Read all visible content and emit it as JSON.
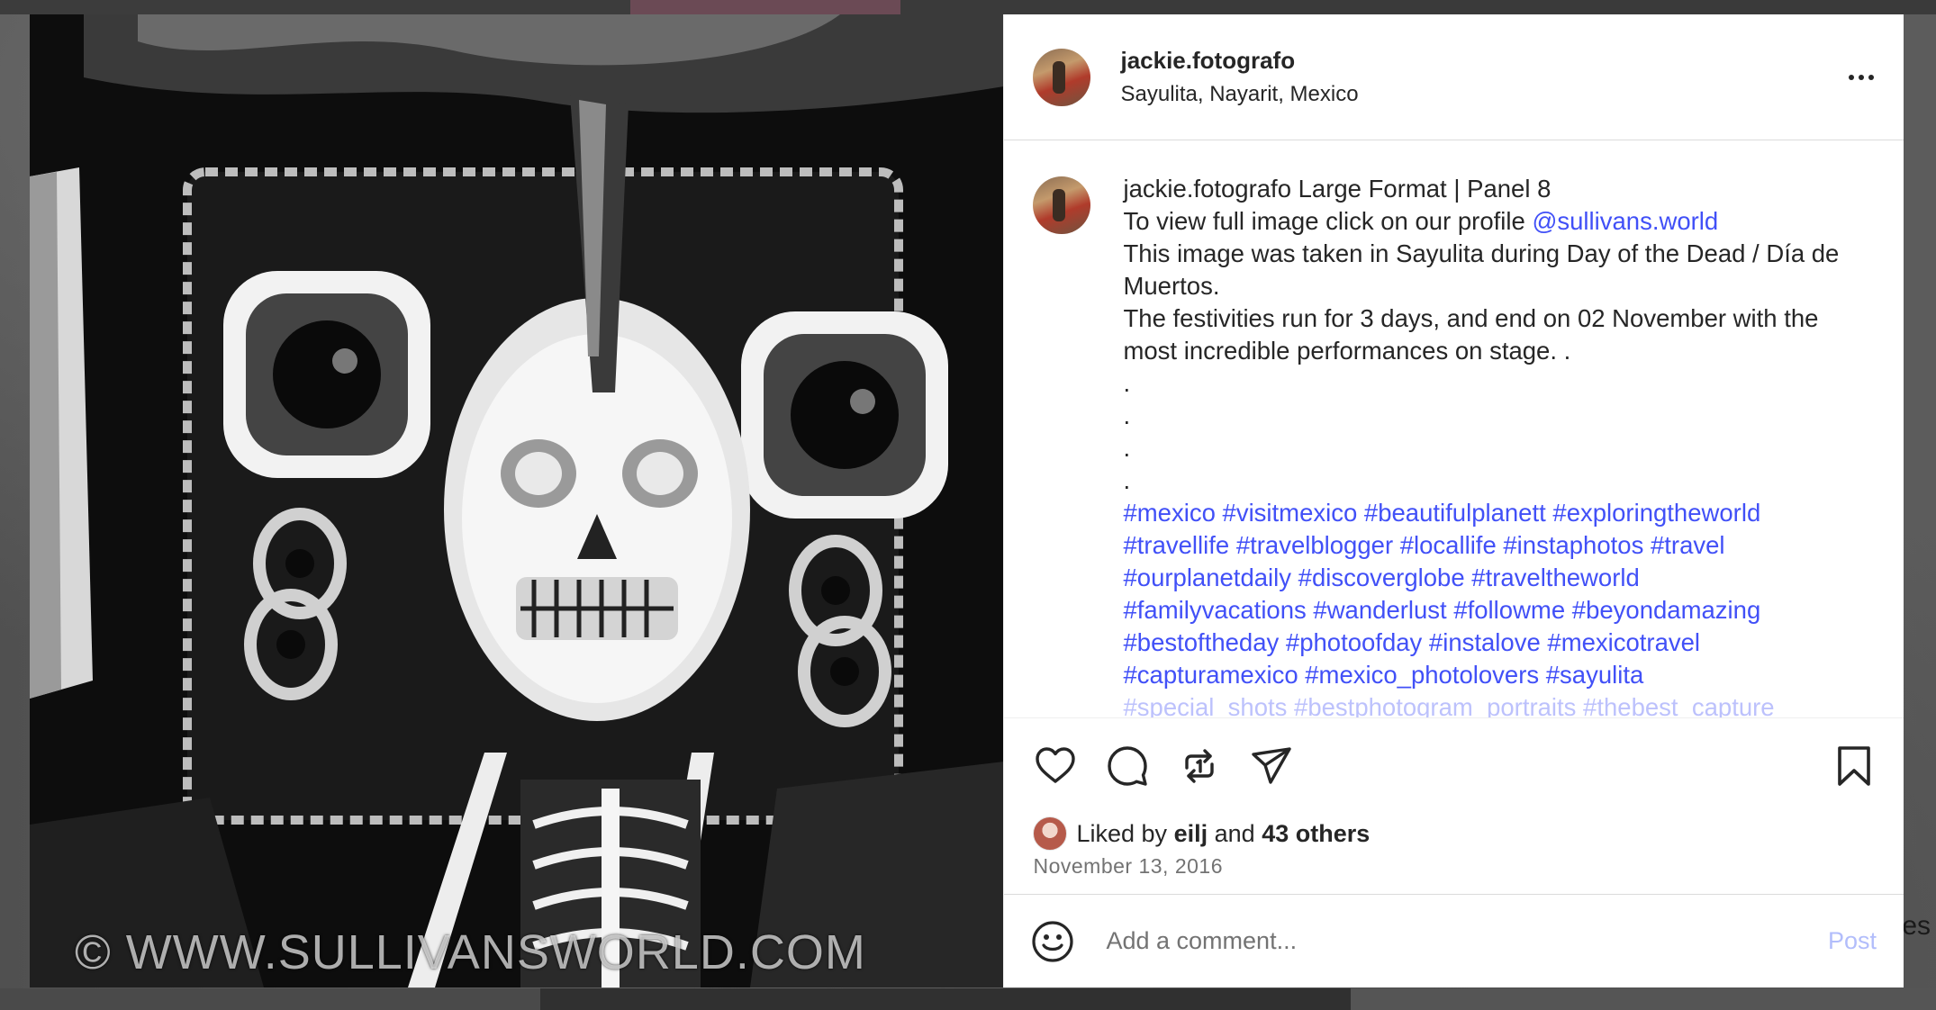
{
  "post": {
    "username": "jackie.fotografo",
    "location": "Sayulita, Nayarit, Mexico"
  },
  "photo": {
    "watermark": "© WWW.SULLIVANSWORLD.COM"
  },
  "caption": {
    "username": "jackie.fotografo",
    "title": "Large Format | Panel 8",
    "line2_prefix": "To view full image click on our profile",
    "mention": "@sullivans.world",
    "line3": "This image was taken in Sayulita during Day of the Dead / Día de Muertos.",
    "line4": "The festivities run for 3 days, and end on 02 November with the most incredible performances on stage. .",
    "dots": [
      ".",
      ".",
      ".",
      "."
    ],
    "hashtags": [
      "#mexico #visitmexico #beautifulplanett #exploringtheworld",
      "#travellife #travelblogger #locallife #instaphotos #travel",
      "#ourplanetdaily #discoverglobe #traveltheworld",
      "#familyvacations #wanderlust #followme #beyondamazing",
      "#bestoftheday #photoofday #instalove #mexicotravel",
      "#capturamexico #mexico_photolovers #sayulita",
      "#special_shots #bestphotogram_portraits #thebest_capture"
    ]
  },
  "actions": {
    "icons": [
      "heart-icon",
      "comment-icon",
      "repost-icon",
      "share-icon",
      "bookmark-icon"
    ]
  },
  "likes": {
    "prefix": "Liked by",
    "user": "eilj",
    "conjunction": "and",
    "others": "43 others"
  },
  "date": "November 13, 2016",
  "comment": {
    "placeholder": "Add a comment...",
    "post_label": "Post"
  },
  "background": {
    "side_text": "es"
  },
  "colors": {
    "link": "#4150f7",
    "post_disabled": "#b2bdfb",
    "text": "#262626",
    "muted": "#737373"
  }
}
